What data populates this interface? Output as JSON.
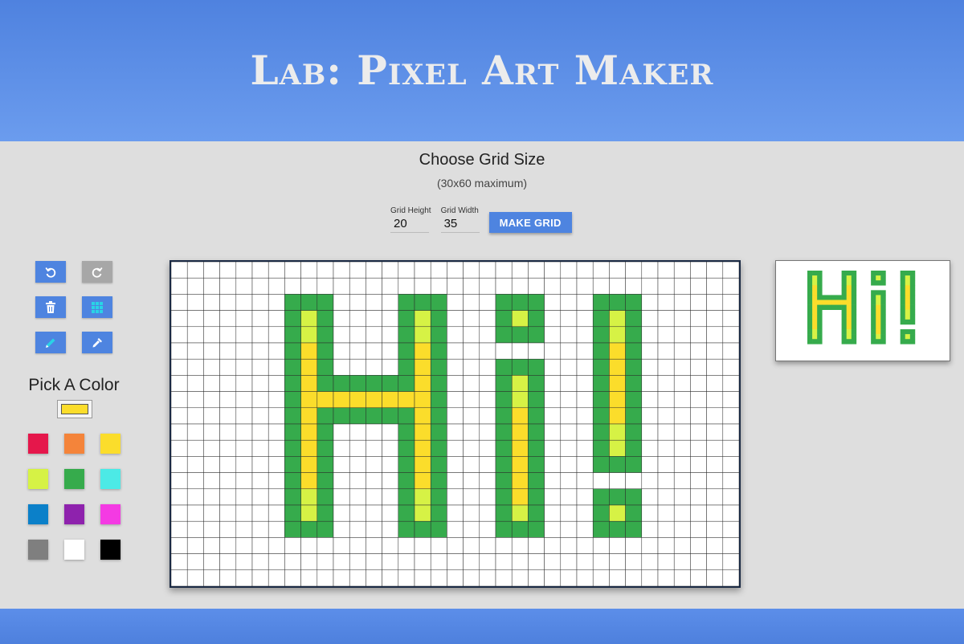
{
  "header": {
    "title": "Lab: Pixel Art Maker"
  },
  "grid_size": {
    "title": "Choose Grid Size",
    "subtitle": "(30x60 maximum)",
    "height_label": "Grid Height",
    "height_value": "20",
    "width_label": "Grid Width",
    "width_value": "35",
    "make_button": "MAKE GRID"
  },
  "tools": [
    {
      "name": "undo-icon",
      "enabled": true
    },
    {
      "name": "redo-icon",
      "enabled": false
    },
    {
      "name": "trash-icon",
      "enabled": true
    },
    {
      "name": "grid-icon",
      "enabled": true
    },
    {
      "name": "pencil-icon",
      "enabled": true
    },
    {
      "name": "eyedropper-icon",
      "enabled": true
    }
  ],
  "palette": {
    "title": "Pick A Color",
    "current": "#fbdd2b",
    "colors": [
      "#e5174b",
      "#f4843a",
      "#fbdd2b",
      "#d6f245",
      "#36ab4c",
      "#4ceae6",
      "#0b80c9",
      "#8e22ad",
      "#f43ae3",
      "#7f7f7f",
      "#ffffff",
      "#000000"
    ]
  },
  "canvas": {
    "rows": 20,
    "cols": 35,
    "key": {
      ".": "#ffffff",
      "G": "#36ab4c",
      "L": "#d6f245",
      "Y": "#fbdd2b"
    },
    "pixels": [
      "...................................",
      "...................................",
      ".......GGG....GGG...GGG...GGG......",
      ".......GLG....GLG...GLG...GLG......",
      ".......GLG....GLG...GGG...GLG......",
      ".......GYG....GYG.........GYG......",
      ".......GYG....GYG...GGG...GYG......",
      ".......GYGGGGGGYG...GLG...GYG......",
      ".......GYYYYYYYYG...GLG...GYG......",
      ".......GYGGGGGGYG...GYG...GYG......",
      ".......GYG....GYG...GYG...GLG......",
      ".......GYG....GYG...GYG...GLG......",
      ".......GYG....GYG...GYG...GGG......",
      ".......GYG....GYG...GYG............",
      ".......GLG....GLG...GYG...GGG......",
      ".......GLG....GLG...GLG...GLG......",
      ".......GGG....GGG...GGG...GGG......",
      "...................................",
      "...................................",
      "..................................."
    ]
  }
}
